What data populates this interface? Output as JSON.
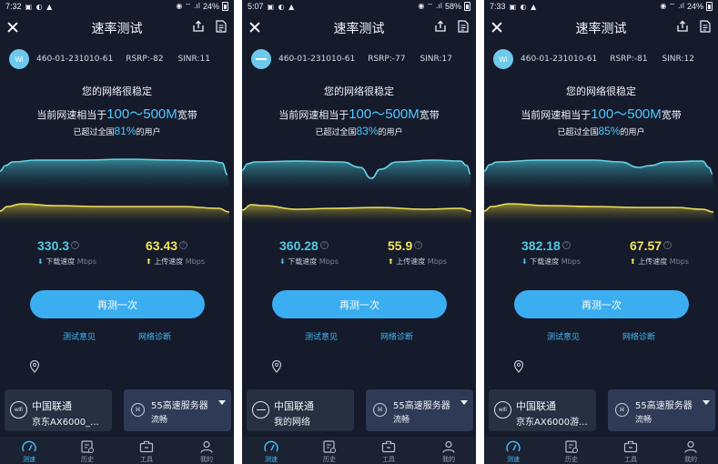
{
  "screens": [
    {
      "status": {
        "time": "7:32",
        "battery": "24%"
      },
      "title": "速率测试",
      "network_badge": "Wi",
      "cell_id": "460-01-231010-61",
      "rsrp": "RSRP:-82",
      "sinr": "SINR:11",
      "message_stable": "您的网络很稳定",
      "equiv_prefix": "当前网速相当于",
      "equiv_value": "100～500M",
      "equiv_suffix": "宽带",
      "beat_prefix": "已超过全国",
      "beat_percent": "81%",
      "beat_suffix": "的用户",
      "download_value": "330.3",
      "download_label": "下载速度",
      "upload_value": "63.43",
      "upload_label": "上传速度",
      "unit": "Mbps",
      "retest_label": "再测一次",
      "feedback_label": "测试意见",
      "diagnose_label": "网络诊断",
      "isp_name": "中国联通",
      "isp_icon_text": "wifi",
      "network_name": "京东AX6000_...",
      "server_name": "55高速服务器",
      "server_status": "流畅",
      "tabs": [
        "测速",
        "历史",
        "工具",
        "我的"
      ]
    },
    {
      "status": {
        "time": "5:07",
        "battery": "58%"
      },
      "title": "速率测试",
      "network_badge": "",
      "cell_id": "460-01-231010-61",
      "rsrp": "RSRP:-77",
      "sinr": "SINR:17",
      "message_stable": "您的网络很稳定",
      "equiv_prefix": "当前网速相当于",
      "equiv_value": "100～500M",
      "equiv_suffix": "宽带",
      "beat_prefix": "已超过全国",
      "beat_percent": "83%",
      "beat_suffix": "的用户",
      "download_value": "360.28",
      "download_label": "下载速度",
      "upload_value": "55.9",
      "upload_label": "上传速度",
      "unit": "Mbps",
      "retest_label": "再测一次",
      "feedback_label": "测试意见",
      "diagnose_label": "网络诊断",
      "isp_name": "中国联通",
      "isp_icon_text": "",
      "network_name": "我的网络",
      "server_name": "55高速服务器",
      "server_status": "流畅",
      "tabs": [
        "测速",
        "历史",
        "工具",
        "我的"
      ]
    },
    {
      "status": {
        "time": "7:33",
        "battery": "24%"
      },
      "title": "速率测试",
      "network_badge": "Wi",
      "cell_id": "460-01-231010-61",
      "rsrp": "RSRP:-81",
      "sinr": "SINR:12",
      "message_stable": "您的网络很稳定",
      "equiv_prefix": "当前网速相当于",
      "equiv_value": "100～500M",
      "equiv_suffix": "宽带",
      "beat_prefix": "已超过全国",
      "beat_percent": "85%",
      "beat_suffix": "的用户",
      "download_value": "382.18",
      "download_label": "下载速度",
      "upload_value": "67.57",
      "upload_label": "上传速度",
      "unit": "Mbps",
      "retest_label": "再测一次",
      "feedback_label": "测试意见",
      "diagnose_label": "网络诊断",
      "isp_name": "中国联通",
      "isp_icon_text": "wifi",
      "network_name": "京东AX6000游...",
      "server_name": "55高速服务器",
      "server_status": "流畅",
      "tabs": [
        "测速",
        "历史",
        "工具",
        "我的"
      ]
    }
  ],
  "colors": {
    "background": "#151b2b",
    "accent": "#3aaef0",
    "download": "#56c7e0",
    "upload": "#f3e35a"
  }
}
